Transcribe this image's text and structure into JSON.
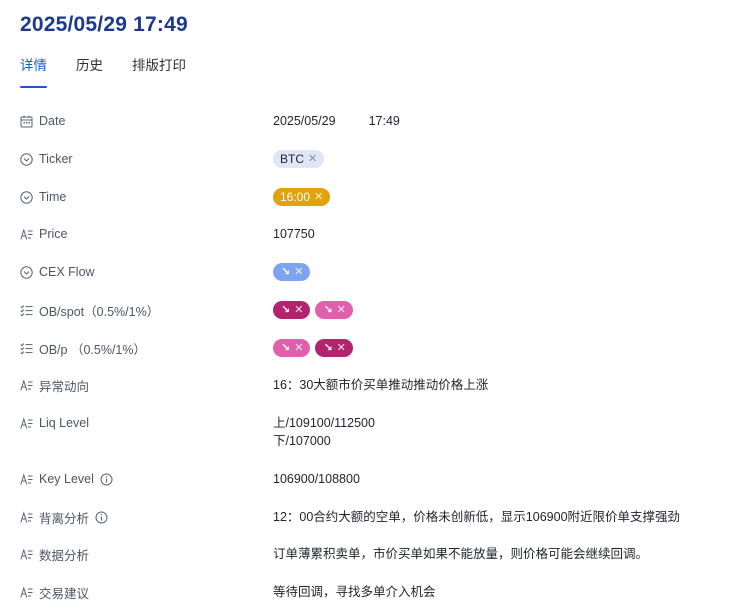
{
  "header": {
    "title": "2025/05/29 17:49"
  },
  "tabs": [
    {
      "label": "详情",
      "active": true
    },
    {
      "label": "历史",
      "active": false
    },
    {
      "label": "排版打印",
      "active": false
    }
  ],
  "fields": {
    "date": {
      "label": "Date",
      "date": "2025/05/29",
      "time": "17:49"
    },
    "ticker": {
      "label": "Ticker",
      "tag": "BTC"
    },
    "time": {
      "label": "Time",
      "tag": "16:00"
    },
    "price": {
      "label": "Price",
      "value": "107750"
    },
    "cex_flow": {
      "label": "CEX Flow",
      "tags": [
        {
          "arrow": "↘",
          "color": "#7ea4f0"
        }
      ]
    },
    "ob_spot": {
      "label": "OB/spot（0.5%/1%）",
      "tags": [
        {
          "arrow": "↘",
          "color": "#b3246e"
        },
        {
          "arrow": "↘",
          "color": "#e060ad"
        }
      ]
    },
    "ob_p": {
      "label": "OB/p （0.5%/1%）",
      "tags": [
        {
          "arrow": "↘",
          "color": "#e060ad"
        },
        {
          "arrow": "↘",
          "color": "#b3246e"
        }
      ]
    },
    "anomaly": {
      "label": "异常动向",
      "value": "16：30大额市价买单推动推动价格上涨"
    },
    "liq_level": {
      "label": "Liq Level",
      "line1": "上/109100/112500",
      "line2": "下/107000"
    },
    "key_level": {
      "label": "Key Level",
      "value": "106900/108800"
    },
    "divergence": {
      "label": "背离分析",
      "value": "12：00合约大额的空单，价格未创新低，显示106900附近限价单支撑强劲"
    },
    "data_analysis": {
      "label": "数据分析",
      "value": "订单薄累积卖单，市价买单如果不能放量，则价格可能会继续回调。"
    },
    "trade_advice": {
      "label": "交易建议",
      "value": "等待回调，寻找多单介入机会"
    }
  },
  "icons": {
    "calendar": "calendar-icon",
    "select": "chevron-circle-icon",
    "text": "text-field-icon",
    "multi": "checklist-icon",
    "info": "info-icon"
  },
  "colors": {
    "accent": "#1d57c9",
    "title": "#1d3a8a",
    "time_tag": "#e1a20c"
  },
  "tag_remove_glyph": "✕"
}
